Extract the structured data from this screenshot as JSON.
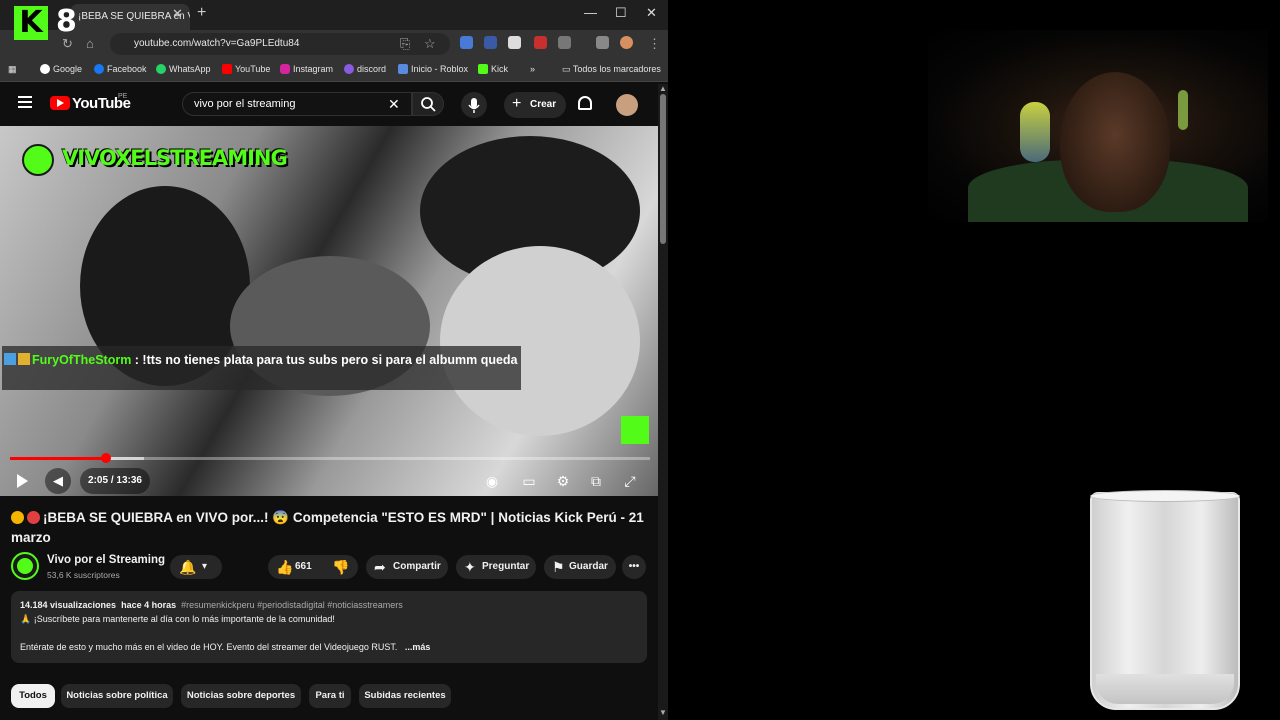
{
  "browser": {
    "overlay_number": "8",
    "tab_title": "¡BEBA SE QUIEBRA en VIVO por...",
    "url": "youtube.com/watch?v=Ga9PLEdtu84",
    "bookmarks": [
      "Google",
      "Facebook",
      "WhatsApp",
      "YouTube",
      "Instagram",
      "discord",
      "Inicio - Roblox",
      "Kick"
    ],
    "all_bookmarks": "Todos los marcadores",
    "more": "»"
  },
  "youtube": {
    "logo_text": "YouTube",
    "country": "PE",
    "search_value": "vivo por el streaming",
    "create_label": "Crear"
  },
  "video": {
    "watermark": "VIVOXELSTREAMING",
    "chat_user": "FuryOfTheStorm",
    "chat_message": " : !tts no tienes plata para tus subs pero si para el albumm queda",
    "time": "2:05 / 13:36",
    "progress": 0.15,
    "buffered": 0.21
  },
  "meta": {
    "title": "¡BEBA SE QUIEBRA en VIVO por...! 😨 Competencia \"ESTO ES MRD\" | Noticias Kick Perú - 21 marzo",
    "channel_name": "Vivo por el Streaming",
    "subscribers": "53,6 K suscriptores",
    "likes": "661",
    "share": "Compartir",
    "ask": "Preguntar",
    "save": "Guardar"
  },
  "description": {
    "views": "14.184 visualizaciones",
    "ago": "hace 4 horas",
    "tags": "#resumenkickperu #periodistadigital #noticiasstreamers",
    "line2": "🙏 ¡Suscríbete para mantenerte al día con lo más importante de la comunidad!",
    "line3": "Entérate de esto y mucho más en el video de HOY. Evento del streamer del Videojuego RUST.",
    "more": "...más"
  },
  "chips": [
    "Todos",
    "Noticias sobre política",
    "Noticias sobre deportes",
    "Para ti",
    "Subidas recientes"
  ],
  "colors": {
    "kick_green": "#53fc18",
    "yt_red": "#ff0000",
    "bg": "#0f0f0f"
  }
}
